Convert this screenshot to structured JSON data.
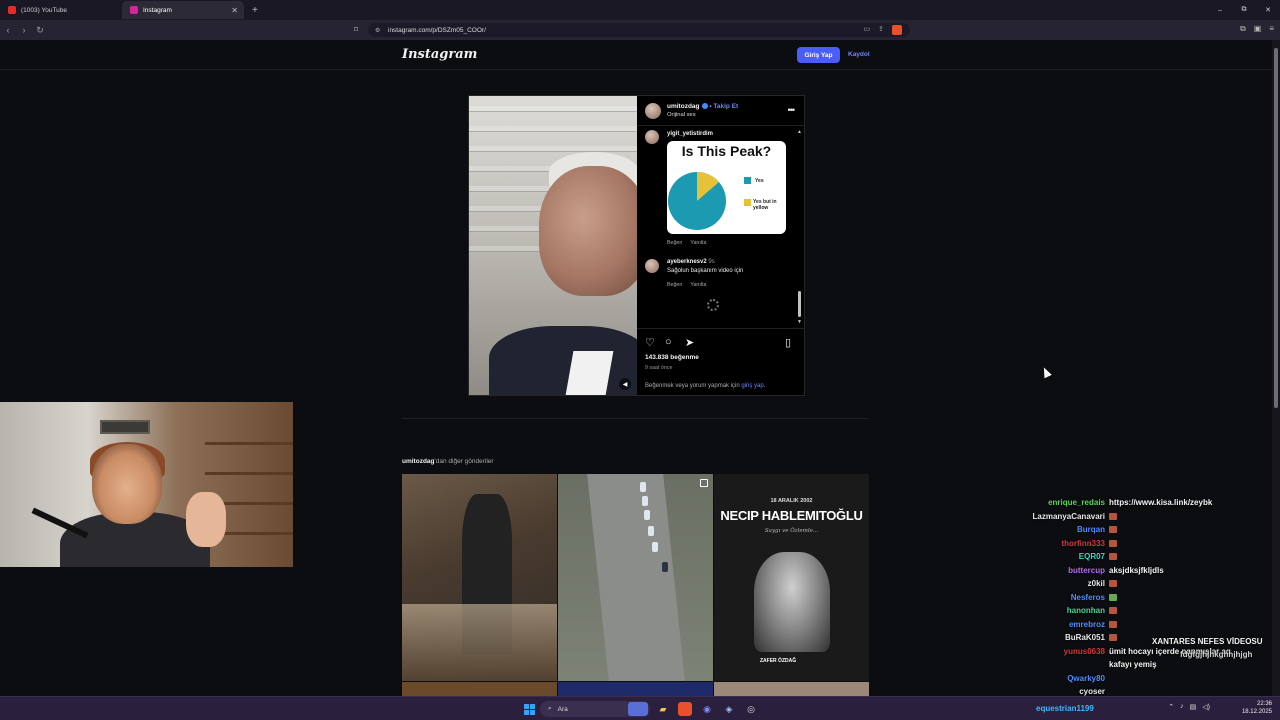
{
  "browser": {
    "tabs": [
      {
        "label": "(1003) YouTube",
        "active": false,
        "favicon_color": "#e52d27"
      },
      {
        "label": "Instagram",
        "active": true,
        "favicon_color": "#d6249f"
      }
    ],
    "new_tab": "+",
    "url": "instagram.com/p/DSZm05_COOr/",
    "window_controls": [
      "–",
      "⧉",
      "✕"
    ]
  },
  "instagram": {
    "logo": "Instagram",
    "login_button": "Giriş Yap",
    "signup_link": "Kaydol",
    "post": {
      "username": "umitozdag",
      "follow": "• Takip Et",
      "audio": "Orijinal ses",
      "more": "•••",
      "comments": [
        {
          "user": "yigit_yetistirdim",
          "meme": {
            "title": "Is This Peak?",
            "legend": [
              "Yes",
              "Yes but in yellow"
            ],
            "colors": [
              "#1b9ab1",
              "#e6c23a"
            ]
          },
          "actions": [
            "Beğen",
            "Yanıtla"
          ]
        },
        {
          "user": "ayeberknesv2",
          "time": "9s",
          "text": "Sağolun başkanım video için",
          "actions": [
            "Beğen",
            "Yanıtla"
          ]
        }
      ],
      "likes": "143.838 beğenme",
      "time_ago": "9 saat önce",
      "login_prompt_prefix": "Beğenmek veya yorum yapmak için ",
      "login_prompt_link": "giriş yap",
      "login_prompt_suffix": "."
    },
    "more_posts": {
      "user": "umitozdag",
      "suffix": "'dan diğer gönderiler"
    },
    "tiles": {
      "necip_date": "18 ARALIK 2002",
      "necip_name": "NECIP HABLEMITOĞLU",
      "necip_sub": "Saygı ve Özlemle...",
      "party": "ZAFER ÖZDAĞ"
    }
  },
  "chat": [
    {
      "name": "enrique_redais",
      "color": "#5bd75b",
      "message": "https://www.kisa.link/zeybk",
      "emote": ""
    },
    {
      "name": "LazmanyaCanavari",
      "color": "#e6e6e6",
      "message": "",
      "emote": "#b5553c"
    },
    {
      "name": "Burqan",
      "color": "#4f8dff",
      "message": "",
      "emote": "#b5553c"
    },
    {
      "name": "thorfinn333",
      "color": "#d43a3a",
      "message": "",
      "emote": "#b5553c"
    },
    {
      "name": "EQR07",
      "color": "#3fd6c8",
      "message": "",
      "emote": "#b5553c"
    },
    {
      "name": "buttercup",
      "color": "#b36bff",
      "message": "aksjdksjfkljdls",
      "emote": ""
    },
    {
      "name": "z0kil",
      "color": "#e6e6e6",
      "message": "",
      "emote": "#b5553c"
    },
    {
      "name": "Nesferos",
      "color": "#4f8dff",
      "message": "",
      "emote": "#6aa84f"
    },
    {
      "name": "hanonhan",
      "color": "#3fd69a",
      "message": "",
      "emote": "#b5553c"
    },
    {
      "name": "emrebroz",
      "color": "#4f8dff",
      "message": "",
      "emote": "#b5553c"
    },
    {
      "name": "BuRaK051",
      "color": "#e6e6e6",
      "message": "",
      "emote": "#b5553c"
    },
    {
      "name": "yunus0638",
      "color": "#d43a3a",
      "message": "ümit hocayı içerde napmışlar aq",
      "emote": ""
    },
    {
      "name": "",
      "color": "#e6e6e6",
      "message": "kafayı yemiş",
      "emote": ""
    },
    {
      "name": "Qwarky80",
      "color": "#4f8dff",
      "message": "",
      "emote": ""
    },
    {
      "name": "cyoser",
      "color": "#e6e6e6",
      "message": "",
      "emote": ""
    }
  ],
  "overlay": {
    "title": "XANTARES NEFES VİDEOSU",
    "subtitle": "fdgfgjhjhkghhjhjgh"
  },
  "chat_bottom": "equestrian1199",
  "taskbar": {
    "search_placeholder": "Ara",
    "time": "22:36",
    "date": "18.12.2025"
  }
}
